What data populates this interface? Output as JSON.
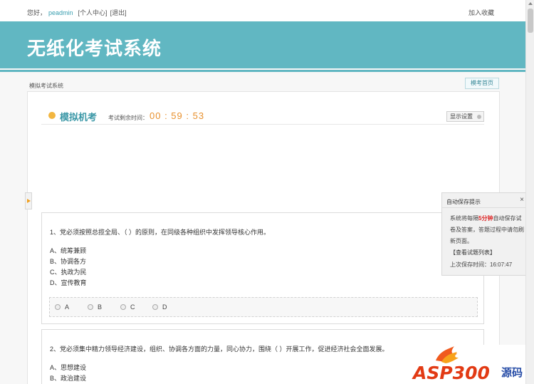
{
  "topbar": {
    "greeting": "您好，",
    "username": "peadmin",
    "user_center": "[个人中心]",
    "logout": "[退出]",
    "favorite": "加入收藏"
  },
  "banner": {
    "title": "无纸化考试系统"
  },
  "breadcrumb": {
    "text": "模拟考试系统",
    "home_button": "模考首页"
  },
  "exam": {
    "title": "模拟机考",
    "timer_label": "考试剩余时间：",
    "timer": "00 : 59 : 53",
    "display_settings": "显示设置"
  },
  "questions": [
    {
      "text": "1、党必须按照总揽全局、（ ）的原则，在同级各种组织中发挥领导核心作用。",
      "options": [
        "A、统筹兼顾",
        "B、协调各方",
        "C、执政为民",
        "D、宣传教育"
      ],
      "choices": [
        "A",
        "B",
        "C",
        "D"
      ]
    },
    {
      "text": "2、党必须集中精力领导经济建设，组织、协调各方面的力量，同心协力，围绕（ ）开展工作，促进经济社会全面发展。",
      "options": [
        "A、思想建设",
        "B、政治建设"
      ]
    }
  ],
  "autosave": {
    "title": "自动保存提示",
    "close": "×",
    "body_prefix": "系统将每隔",
    "interval": "5分钟",
    "body_suffix": "自动保存试卷及答案，答题过程中请勿刷新页面。",
    "link": "【查看试题列表】",
    "last_saved": "上次保存时间：16:07:47"
  },
  "watermark": {
    "brand": "ASP300",
    "suffix": "源码"
  },
  "colors": {
    "accent": "#61b7c2",
    "timer": "#e8912e",
    "title": "#3a97a6",
    "dot": "#f2b640"
  }
}
